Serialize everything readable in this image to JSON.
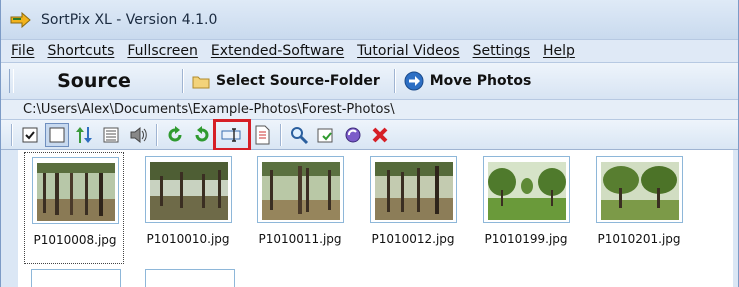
{
  "window": {
    "title": "SortPix XL - Version 4.1.0"
  },
  "menu": [
    "File",
    "Shortcuts",
    "Fullscreen",
    "Extended-Software",
    "Tutorial Videos",
    "Settings",
    "Help"
  ],
  "bigbar": {
    "source_label": "Source",
    "select_folder_label": "Select Source-Folder",
    "move_photos_label": "Move Photos"
  },
  "path": "C:\\Users\\Alex\\Documents\\Example-Photos\\Forest-Photos\\",
  "toolbar": {
    "icons": [
      "check-all-icon",
      "uncheck-all-icon",
      "sort-icon",
      "list-view-icon",
      "sound-icon",
      "rotate-left-icon",
      "rotate-right-icon",
      "rename-icon",
      "document-icon",
      "search-icon",
      "export-icon",
      "refresh-icon",
      "delete-icon"
    ],
    "highlighted": "rename-icon"
  },
  "thumbnails": [
    {
      "name": "P1010008.jpg",
      "selected": true
    },
    {
      "name": "P1010010.jpg",
      "selected": false
    },
    {
      "name": "P1010011.jpg",
      "selected": false
    },
    {
      "name": "P1010012.jpg",
      "selected": false
    },
    {
      "name": "P1010199.jpg",
      "selected": false
    },
    {
      "name": "P1010201.jpg",
      "selected": false
    }
  ],
  "colors": {
    "highlight": "#d61f26",
    "chrome": "#dbe7f5",
    "thumb_border": "#8eb7d9"
  }
}
